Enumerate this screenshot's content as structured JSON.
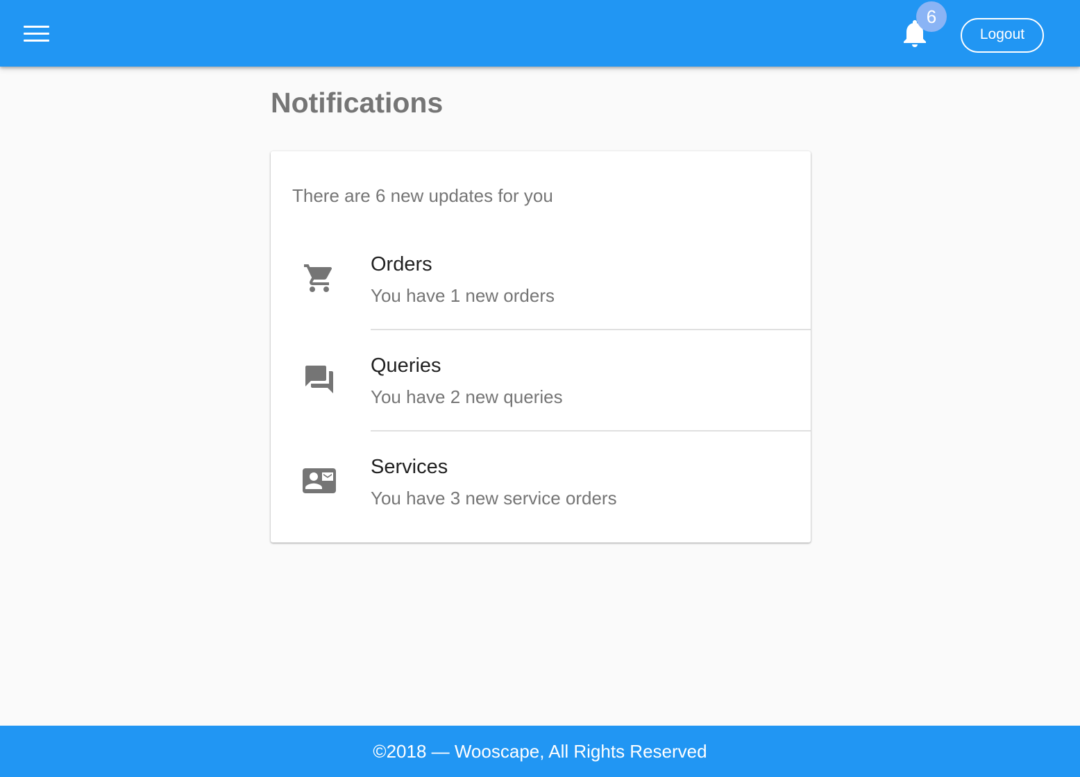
{
  "header": {
    "menu_icon": "menu-icon",
    "notification_icon": "bell-icon",
    "notification_count": "6",
    "logout_label": "Logout",
    "bar_color": "#2196f3"
  },
  "page": {
    "title": "Notifications"
  },
  "card": {
    "subheader": "There are 6 new updates for you",
    "items": [
      {
        "icon": "cart-icon",
        "title": "Orders",
        "subtitle": "You have 1 new orders"
      },
      {
        "icon": "forum-icon",
        "title": "Queries",
        "subtitle": "You have 2 new queries"
      },
      {
        "icon": "contact-mail-icon",
        "title": "Services",
        "subtitle": "You have 3 new service orders"
      }
    ]
  },
  "footer": {
    "text": "©2018 — Wooscape, All Rights Reserved"
  }
}
